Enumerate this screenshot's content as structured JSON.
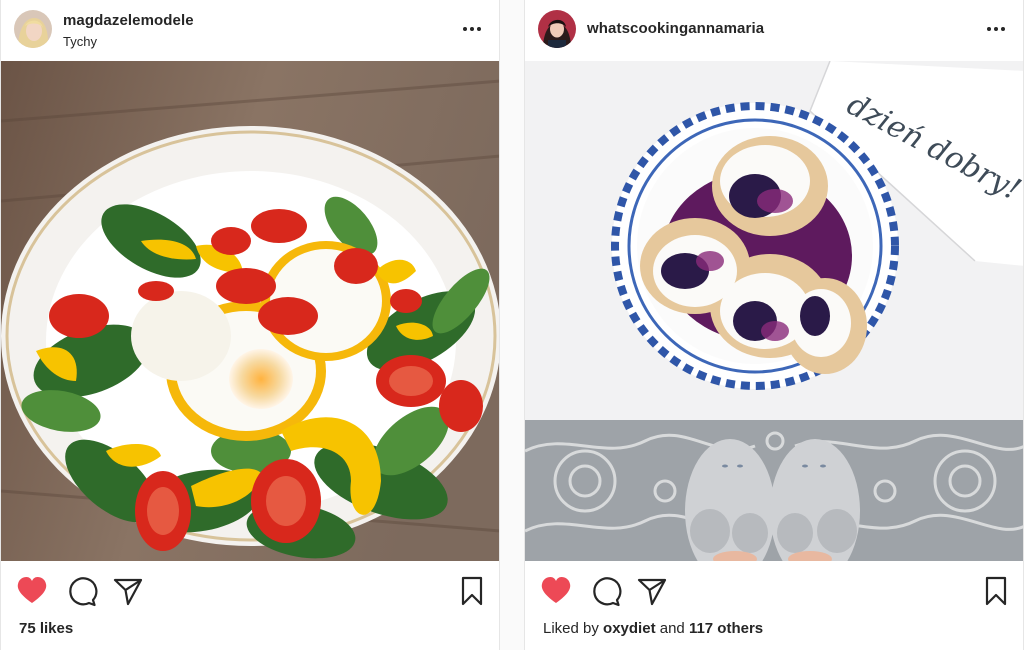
{
  "posts": [
    {
      "username": "magdazelemodele",
      "location": "Tychy",
      "image_alt": "Salad with fried eggs in pepper rings, tomatoes and lamb's lettuce",
      "likes_text": "75 likes",
      "liked": true,
      "icons": [
        "more-options-icon",
        "heart-icon",
        "comment-icon",
        "share-icon",
        "bookmark-icon"
      ]
    },
    {
      "username": "whatscookingannamaria",
      "location": "",
      "image_text": "dzień dobry!",
      "likes_prefix": "Liked by",
      "liked_by": "oxydiet",
      "likes_and": "and",
      "likes_others": "117 others",
      "liked": true,
      "icons": [
        "more-options-icon",
        "heart-icon",
        "comment-icon",
        "share-icon",
        "bookmark-icon"
      ]
    }
  ],
  "colors": {
    "heart": "#ed4956",
    "text": "#262626",
    "border": "#e6e6e6"
  }
}
